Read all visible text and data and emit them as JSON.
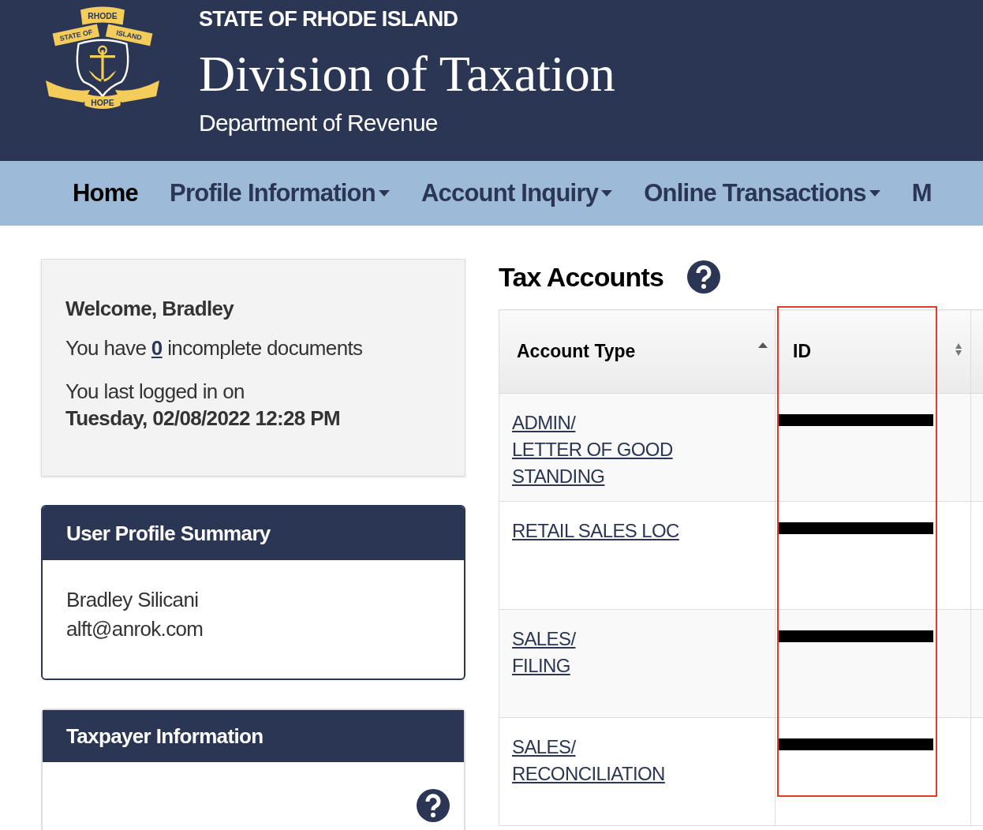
{
  "header": {
    "logo": {
      "top_ribbon": "RHODE",
      "left_ribbon": "STATE OF",
      "right_ribbon": "ISLAND",
      "bottom_ribbon": "HOPE"
    },
    "state": "STATE OF RHODE ISLAND",
    "title": "Division of Taxation",
    "subtitle": "Department of Revenue"
  },
  "nav": [
    {
      "label": "Home",
      "dropdown": false,
      "selected": true
    },
    {
      "label": "Profile Information",
      "dropdown": true,
      "selected": false
    },
    {
      "label": "Account Inquiry",
      "dropdown": true,
      "selected": false
    },
    {
      "label": "Online Transactions",
      "dropdown": true,
      "selected": false
    },
    {
      "label": "M",
      "dropdown": false,
      "selected": false
    }
  ],
  "welcome": {
    "greeting": "Welcome, Bradley",
    "docs_before": "You have ",
    "docs_count": "0",
    "docs_after": " incomplete documents",
    "last_login_label": "You last logged in on",
    "last_login": "Tuesday, 02/08/2022 12:28 PM"
  },
  "profile_summary": {
    "title": "User Profile Summary",
    "name": "Bradley Silicani",
    "email": "alft@anrok.com"
  },
  "taxpayer_info": {
    "title": "Taxpayer Information"
  },
  "tax_accounts": {
    "title": "Tax Accounts",
    "columns": [
      {
        "label": "Account Type",
        "sorted_ascending": true,
        "highlighted": false
      },
      {
        "label": "ID",
        "sorted_ascending": false,
        "highlighted": true
      }
    ],
    "rows": [
      {
        "account_type": "ADMIN/\nLETTER OF GOOD\nSTANDING",
        "id_redacted": true
      },
      {
        "account_type": "RETAIL SALES LOC",
        "id_redacted": true
      },
      {
        "account_type": "SALES/\nFILING",
        "id_redacted": true
      },
      {
        "account_type": "SALES/\nRECONCILIATION",
        "id_redacted": true
      }
    ]
  }
}
